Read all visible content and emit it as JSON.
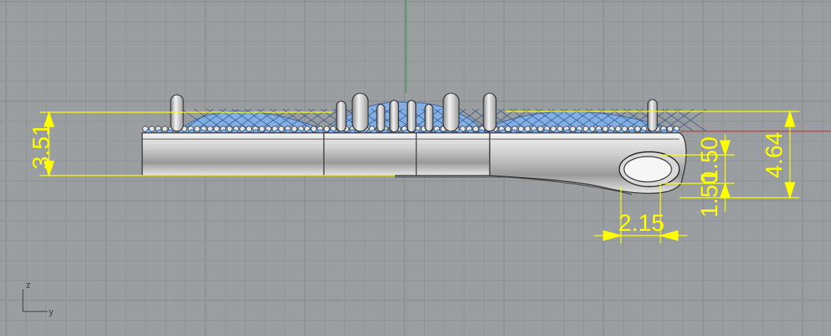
{
  "viewport": {
    "dimensions": [
      {
        "id": "overall-thickness",
        "value": "3.51"
      },
      {
        "id": "total-height",
        "value": "4.64"
      },
      {
        "id": "loop-upper-height",
        "value": "1.50"
      },
      {
        "id": "loop-lower-height",
        "value": "1.50"
      },
      {
        "id": "loop-width",
        "value": "2.15"
      }
    ],
    "axis_labels": {
      "z": "z",
      "y": "y"
    },
    "colors": {
      "background": "#9a9ea1",
      "grid_minor": "#8e9295",
      "grid_major": "#868a8d",
      "dimension": "#ffff00",
      "surface_highlight": "#7fb2f0",
      "x_axis": "#b04040",
      "z_axis": "#2f9a3c"
    }
  }
}
